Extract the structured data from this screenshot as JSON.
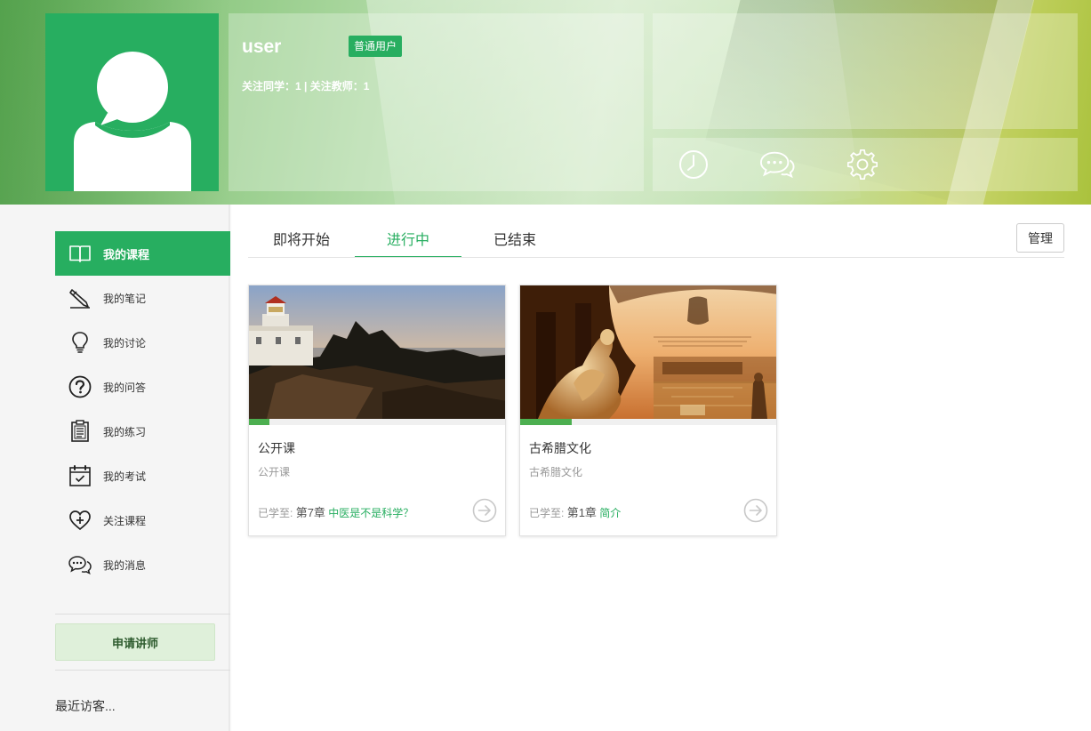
{
  "profile": {
    "username": "user",
    "role_badge": "普通用户",
    "follow_stats": "关注同学：1 | 关注教师：1"
  },
  "header_icons": [
    {
      "icon": "clock-icon"
    },
    {
      "icon": "chat-bubbles-icon"
    },
    {
      "icon": "gear-icon"
    }
  ],
  "sidebar": {
    "items": [
      {
        "label": "我的课程",
        "icon": "book-icon",
        "active": true
      },
      {
        "label": "我的笔记",
        "icon": "pencil-icon"
      },
      {
        "label": "我的讨论",
        "icon": "lightbulb-icon"
      },
      {
        "label": "我的问答",
        "icon": "question-icon"
      },
      {
        "label": "我的练习",
        "icon": "clipboard-icon"
      },
      {
        "label": "我的考试",
        "icon": "calendar-check-icon"
      },
      {
        "label": "关注课程",
        "icon": "heart-plus-icon"
      },
      {
        "label": "我的消息",
        "icon": "message-icon"
      }
    ],
    "apply_button": "申请讲师",
    "recent_visitors": "最近访客..."
  },
  "tabs": [
    {
      "label": "即将开始"
    },
    {
      "label": "进行中",
      "active": true
    },
    {
      "label": "已结束"
    }
  ],
  "manage_button": "管理",
  "courses": [
    {
      "title": "公开课",
      "subtitle": "公开课",
      "progress_prefix": "已学至:",
      "chapter": "第7章",
      "lesson": "中医是不是科学？",
      "progress_fraction": 0.08,
      "image": "lighthouse-sunset-photo"
    },
    {
      "title": "古希腊文化",
      "subtitle": "古希腊文化",
      "progress_prefix": "已学至:",
      "chapter": "第1章",
      "lesson": "简介",
      "progress_fraction": 0.2,
      "image": "greek-statue-photo"
    }
  ],
  "colors": {
    "brand_green": "#27ae60",
    "progress_green": "#4caf50",
    "apply_bg": "#dff0da"
  }
}
